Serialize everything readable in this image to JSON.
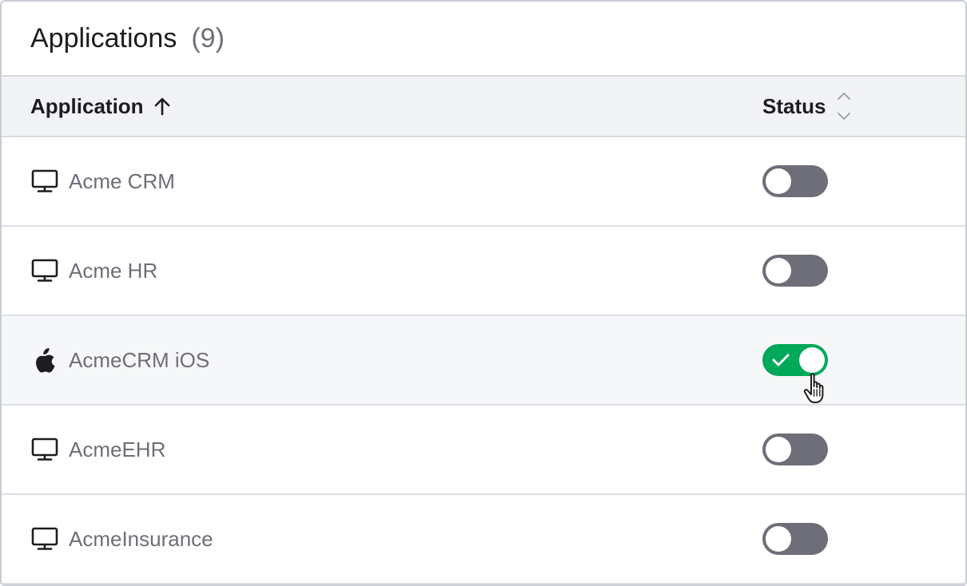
{
  "panel": {
    "title": "Applications",
    "count": "(9)"
  },
  "table": {
    "columns": {
      "application": "Application",
      "status": "Status"
    },
    "sort": {
      "application_icon": "arrow-up-icon",
      "status_icon": "sort-chevrons-icon"
    }
  },
  "rows": [
    {
      "name": "Acme CRM",
      "icon": "desktop-icon",
      "enabled": false
    },
    {
      "name": "Acme HR",
      "icon": "desktop-icon",
      "enabled": false
    },
    {
      "name": "AcmeCRM iOS",
      "icon": "apple-icon",
      "enabled": true
    },
    {
      "name": "AcmeEHR",
      "icon": "desktop-icon",
      "enabled": false
    },
    {
      "name": "AcmeInsurance",
      "icon": "desktop-icon",
      "enabled": false
    }
  ],
  "colors": {
    "toggle_off": "#6e6e78",
    "toggle_on": "#00a859",
    "muted_text": "#6e6e78",
    "header_bg": "#f2f3f5"
  }
}
